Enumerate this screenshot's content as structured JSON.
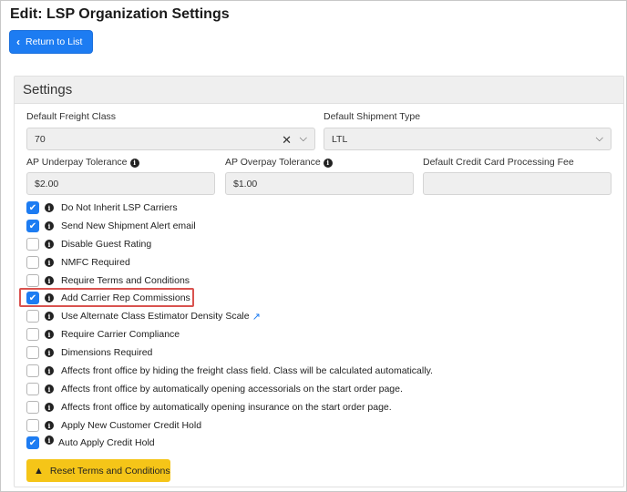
{
  "page": {
    "title": "Edit: LSP Organization Settings",
    "return_label": "Return to List"
  },
  "settings": {
    "header": "Settings",
    "freight_class": {
      "label": "Default Freight Class",
      "value": "70"
    },
    "shipment_type": {
      "label": "Default Shipment Type",
      "value": "LTL"
    },
    "ap_underpay": {
      "label": "AP Underpay Tolerance",
      "value": "$2.00"
    },
    "ap_overpay": {
      "label": "AP Overpay Tolerance",
      "value": "$1.00"
    },
    "cc_fee": {
      "label": "Default Credit Card Processing Fee",
      "value": ""
    }
  },
  "checkboxes": [
    {
      "label": "Do Not Inherit LSP Carriers",
      "checked": true
    },
    {
      "label": "Send New Shipment Alert email",
      "checked": true
    },
    {
      "label": "Disable Guest Rating",
      "checked": false
    },
    {
      "label": "NMFC Required",
      "checked": false
    },
    {
      "label": "Require Terms and Conditions",
      "checked": false
    },
    {
      "label": "Add Carrier Rep Commissions",
      "checked": true
    },
    {
      "label": "Use Alternate Class Estimator Density Scale",
      "checked": false
    },
    {
      "label": "Require Carrier Compliance",
      "checked": false
    },
    {
      "label": "Dimensions Required",
      "checked": false
    },
    {
      "label": "Affects front office by hiding the freight class field. Class will be calculated automatically.",
      "checked": false
    },
    {
      "label": "Affects front office by automatically opening accessorials on the start order page.",
      "checked": false
    },
    {
      "label": "Affects front office by automatically opening insurance on the start order page.",
      "checked": false
    },
    {
      "label": "Apply New Customer Credit Hold",
      "checked": false
    },
    {
      "label": "Auto Apply Credit Hold",
      "checked": true
    }
  ],
  "reset_label": "Reset Terms and Conditions",
  "colors": {
    "primary": "#1d7cf2",
    "warning": "#f5c518",
    "highlight": "#d9534f"
  },
  "icons": {
    "info": "info-circle-icon",
    "external": "external-link-icon",
    "warning": "warning-triangle-icon"
  }
}
